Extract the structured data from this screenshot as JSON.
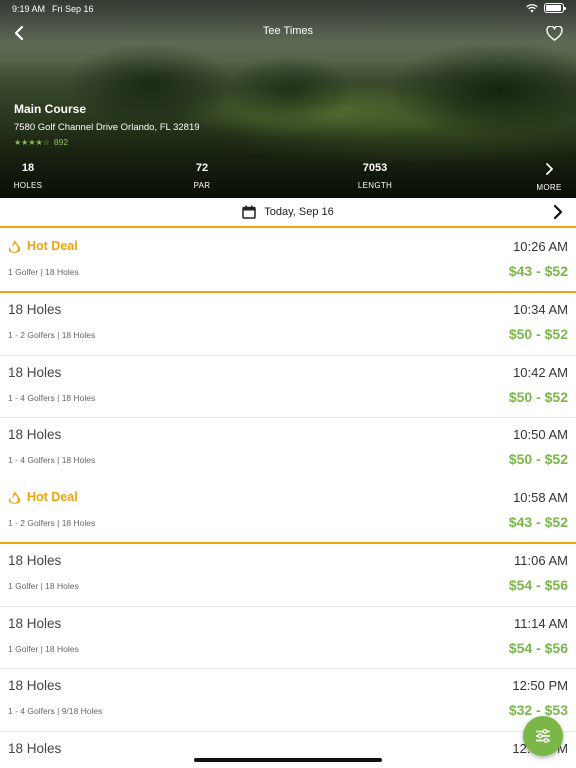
{
  "status_bar": {
    "time": "9:19 AM",
    "date": "Fri Sep 16",
    "battery_level": 0.95
  },
  "nav": {
    "title": "Tee Times",
    "back_icon": "chevron-left-icon",
    "favorite_icon": "heart-icon"
  },
  "course": {
    "name": "Main Course",
    "address": "7580 Golf Channel Drive Orlando, FL 32819",
    "stars": "★★★★☆",
    "rating": 4,
    "review_count": "892"
  },
  "stats": {
    "holes": {
      "value": "18",
      "label": "HOLES"
    },
    "par": {
      "value": "72",
      "label": "PAR"
    },
    "length": {
      "value": "7053",
      "label": "LENGTH"
    },
    "more": {
      "label": "MORE"
    }
  },
  "date_bar": {
    "label": "Today, Sep 16"
  },
  "colors": {
    "hot_deal": "#f0a30a",
    "price": "#7ab648",
    "fab": "#7ab648"
  },
  "tee_times": [
    {
      "title": "Hot Deal",
      "hot": true,
      "details": "1 Golfer | 18 Holes",
      "time": "10:26 AM",
      "price": "$43 - $52"
    },
    {
      "title": "18 Holes",
      "hot": false,
      "details": "1 - 2 Golfers | 18 Holes",
      "time": "10:34 AM",
      "price": "$50 - $52"
    },
    {
      "title": "18 Holes",
      "hot": false,
      "details": "1 - 4 Golfers | 18 Holes",
      "time": "10:42 AM",
      "price": "$50 - $52"
    },
    {
      "title": "18 Holes",
      "hot": false,
      "details": "1 - 4 Golfers | 18 Holes",
      "time": "10:50 AM",
      "price": "$50 - $52"
    },
    {
      "title": "Hot Deal",
      "hot": true,
      "details": "1 - 2 Golfers | 18 Holes",
      "time": "10:58 AM",
      "price": "$43 - $52"
    },
    {
      "title": "18 Holes",
      "hot": false,
      "details": "1 Golfer | 18 Holes",
      "time": "11:06 AM",
      "price": "$54 - $56"
    },
    {
      "title": "18 Holes",
      "hot": false,
      "details": "1 Golfer | 18 Holes",
      "time": "11:14 AM",
      "price": "$54 - $56"
    },
    {
      "title": "18 Holes",
      "hot": false,
      "details": "1 - 4 Golfers | 9/18 Holes",
      "time": "12:50 PM",
      "price": "$32 - $53"
    },
    {
      "title": "18 Holes",
      "hot": false,
      "details": "",
      "time": "12:58 PM",
      "price": ""
    }
  ],
  "fab": {
    "icon": "filter-icon"
  }
}
